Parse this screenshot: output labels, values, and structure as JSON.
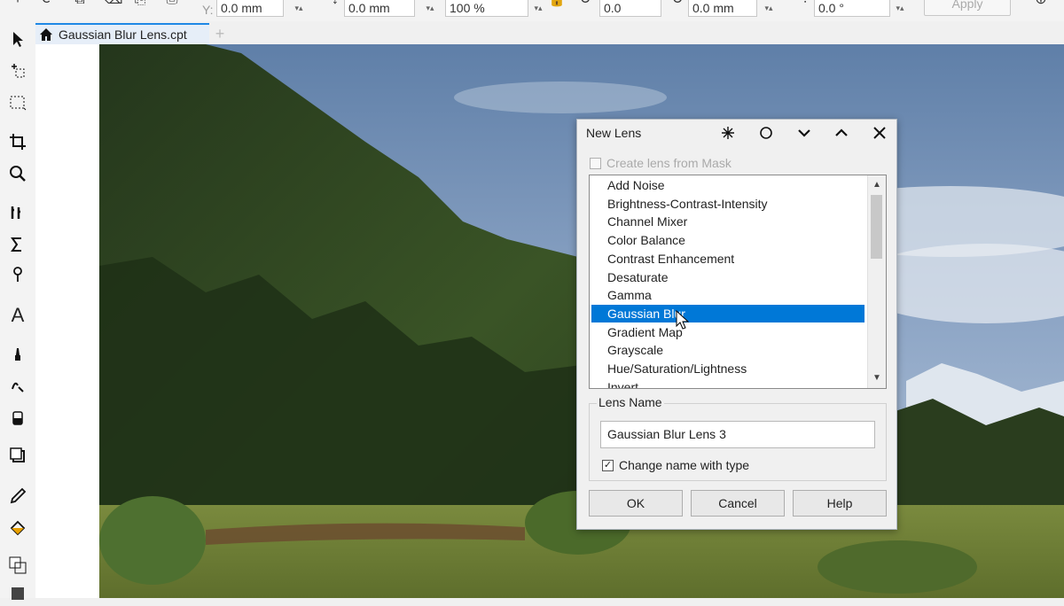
{
  "property_bar": {
    "x_value": "0.0 mm",
    "y_value": "0.0 mm",
    "scale_value": "100 %",
    "angle_value": "0.0",
    "offset_value": "0.0 mm",
    "tilt_value": "0.0 °",
    "apply_label": "Apply"
  },
  "document_tab": {
    "name": "Gaussian Blur Lens.cpt"
  },
  "dialog": {
    "title": "New Lens",
    "create_from_mask_label": "Create lens from Mask",
    "lens_types": [
      "Add Noise",
      "Brightness-Contrast-Intensity",
      "Channel Mixer",
      "Color Balance",
      "Contrast Enhancement",
      "Desaturate",
      "Gamma",
      "Gaussian Blur",
      "Gradient Map",
      "Grayscale",
      "Hue/Saturation/Lightness",
      "Invert"
    ],
    "selected_lens": "Gaussian Blur",
    "lens_name_label": "Lens Name",
    "lens_name_value": "Gaussian Blur Lens 3",
    "change_name_label": "Change name with type",
    "change_name_checked": true,
    "ok_label": "OK",
    "cancel_label": "Cancel",
    "help_label": "Help"
  },
  "colors": {
    "selection": "#0078d7",
    "tab_accent": "#1e88e5"
  }
}
